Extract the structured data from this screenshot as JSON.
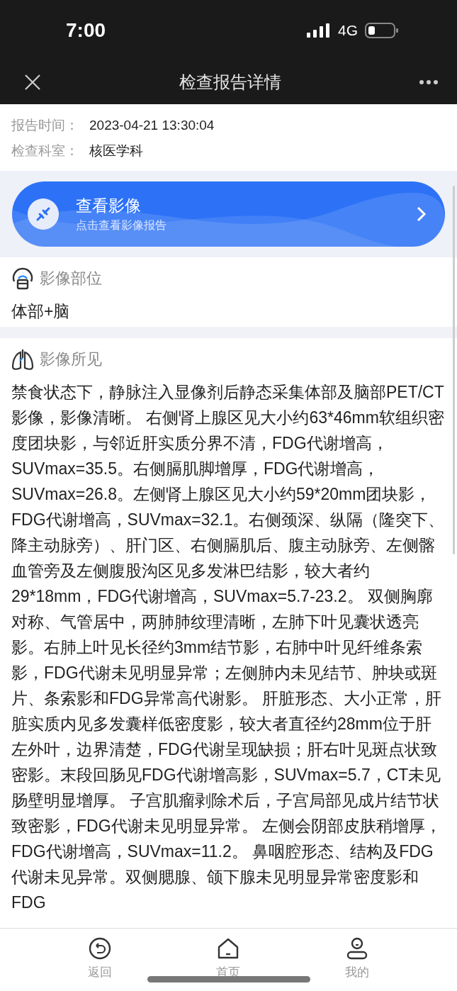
{
  "status_bar": {
    "time": "7:00",
    "network": "4G"
  },
  "nav": {
    "title": "检查报告详情"
  },
  "info": [
    {
      "label": "报告时间：",
      "value": "2023-04-21 13:30:04"
    },
    {
      "label": "检查科室：",
      "value": "核医学科"
    }
  ],
  "banner": {
    "title": "查看影像",
    "subtitle": "点击查看影像报告"
  },
  "sections": [
    {
      "kind": "scanner",
      "heading": "影像部位",
      "body": "体部+脑"
    },
    {
      "kind": "lungs",
      "heading": "影像所见",
      "body": "禁食状态下，静脉注入显像剂后静态采集体部及脑部PET/CT影像，影像清晰。 右侧肾上腺区见大小约63*46mm软组织密度团块影，与邻近肝实质分界不清，FDG代谢增高，SUVmax=35.5。右侧膈肌脚增厚，FDG代谢增高，SUVmax=26.8。左侧肾上腺区见大小约59*20mm团块影，FDG代谢增高，SUVmax=32.1。右侧颈深、纵隔（隆突下、降主动脉旁）、肝门区、右侧膈肌后、腹主动脉旁、左侧髂血管旁及左侧腹股沟区见多发淋巴结影，较大者约29*18mm，FDG代谢增高，SUVmax=5.7-23.2。 双侧胸廓对称、气管居中，两肺肺纹理清晰，左肺下叶见囊状透亮影。右肺上叶见长径约3mm结节影，右肺中叶见纤维条索影，FDG代谢未见明显异常；左侧肺内未见结节、肿块或斑片、条索影和FDG异常高代谢影。 肝脏形态、大小正常，肝脏实质内见多发囊样低密度影，较大者直径约28mm位于肝左外叶，边界清楚，FDG代谢呈现缺损；肝右叶见斑点状致密影。末段回肠见FDG代谢增高影，SUVmax=5.7，CT未见肠壁明显增厚。 子宫肌瘤剥除术后，子宫局部见成片结节状致密影，FDG代谢未见明显异常。 左侧会阴部皮肤稍增厚，FDG代谢增高，SUVmax=11.2。 鼻咽腔形态、结构及FDG代谢未见异常。双侧腮腺、颌下腺未见明显异常密度影和FDG"
    }
  ],
  "tabs": [
    {
      "kind": "back",
      "label": "返回",
      "selected": false
    },
    {
      "kind": "home",
      "label": "首页",
      "selected": false
    },
    {
      "kind": "user",
      "label": "我的",
      "selected": false
    }
  ]
}
